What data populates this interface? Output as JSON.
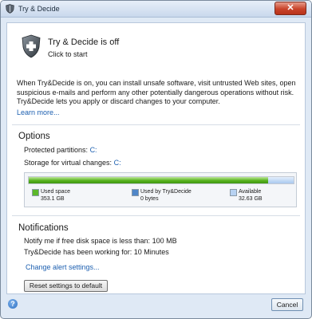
{
  "window": {
    "title": "Try & Decide",
    "close_glyph": "✕"
  },
  "status": {
    "title": "Try & Decide is off",
    "action": "Click to start",
    "icon": "shield-icon"
  },
  "description": "When Try&Decide is on, you can install unsafe software, visit untrusted Web sites, open suspicious e-mails and perform any other potentially dangerous operations without risk. Try&Decide lets you apply or discard changes to your computer.",
  "learn_more": "Learn more...",
  "options": {
    "title": "Options",
    "protected_label": "Protected partitions:",
    "protected_value": "C:",
    "storage_label": "Storage for virtual changes:",
    "storage_value": "C:"
  },
  "disk": {
    "used_fraction": 0.905,
    "available_fraction": 0.095,
    "legend": [
      {
        "label": "Used space",
        "value": "353.1 GB",
        "color": "#5cb82a"
      },
      {
        "label": "Used by Try&Decide",
        "value": "0 bytes",
        "color": "#4f86c8"
      },
      {
        "label": "Available",
        "value": "32.63 GB",
        "color": "#b7d2f2"
      }
    ]
  },
  "notifications": {
    "title": "Notifications",
    "free_space": "Notify me if free disk space is less than: 100 MB",
    "working": "Try&Decide has been working for: 10 Minutes",
    "change_alert": "Change alert settings..."
  },
  "reset_button": "Reset settings to default",
  "footer": {
    "help_glyph": "?",
    "cancel": "Cancel"
  }
}
